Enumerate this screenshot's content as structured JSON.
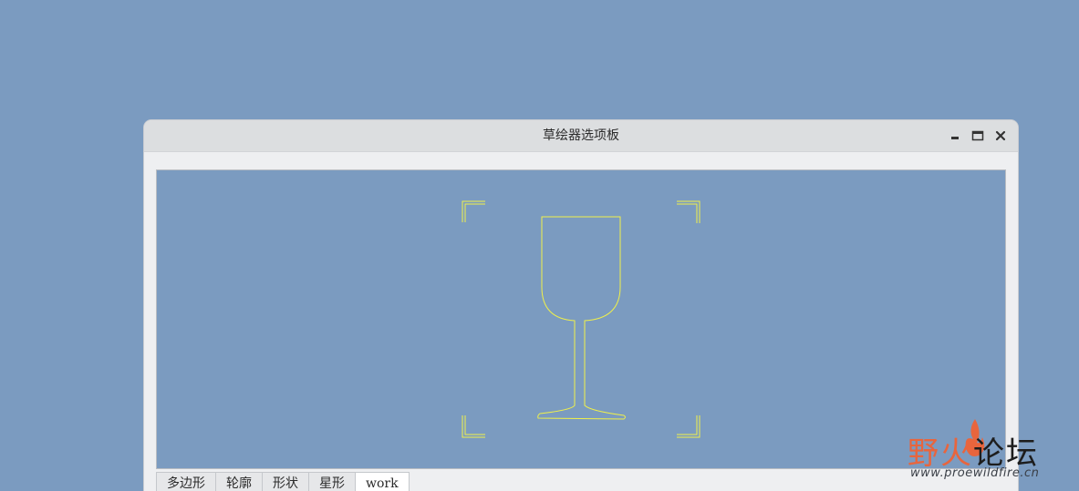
{
  "window": {
    "title": "草绘器选项板"
  },
  "tabs": [
    {
      "label": "多边形",
      "active": false
    },
    {
      "label": "轮廓",
      "active": false
    },
    {
      "label": "形状",
      "active": false
    },
    {
      "label": "星形",
      "active": false
    },
    {
      "label": "work",
      "active": true
    }
  ],
  "preview": {
    "shape": "wine-glass",
    "stroke_color": "#f0f04a"
  },
  "watermark": {
    "title_part1": "野火",
    "title_part2": "论坛",
    "url": "www.proewildfire.cn"
  },
  "colors": {
    "desktop": "#7b9bc0",
    "canvas": "#7b9bc0",
    "window_bg": "#eeeff1",
    "titlebar": "#dcdee0",
    "sketch": "#f0f04a",
    "watermark_accent": "#e8653d"
  }
}
